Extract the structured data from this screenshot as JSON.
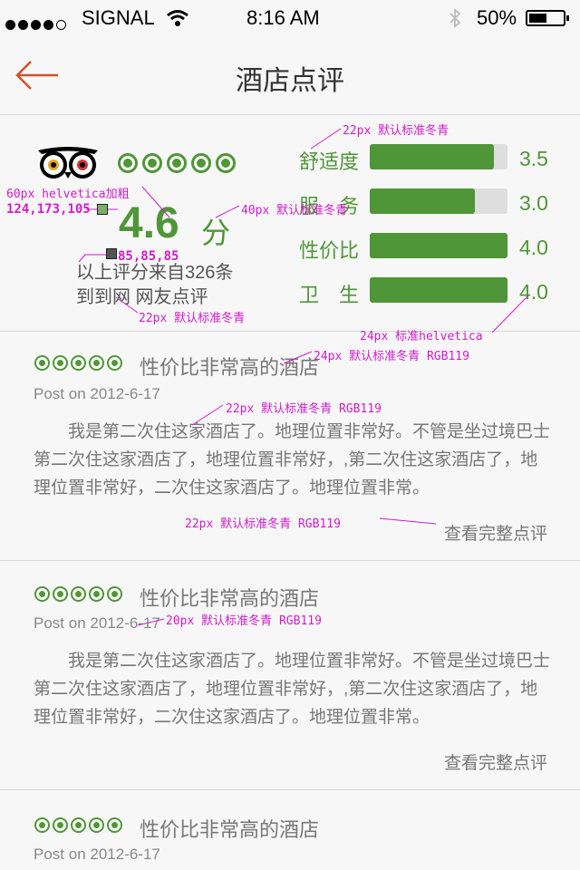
{
  "status_bar": {
    "carrier": "SIGNAL",
    "time": "8:16 AM",
    "battery": "50%",
    "signal_dots_filled": 4,
    "signal_dots_total": 5
  },
  "nav": {
    "title": "酒店点评",
    "back_icon": "back-arrow-icon"
  },
  "summary": {
    "logo": "tripadvisor-owl-logo",
    "score": "4.6",
    "score_unit": "分",
    "rating_dots": 5,
    "source_text_line1": "以上评分来自326条",
    "source_text_line2": "到到网 网友点评",
    "categories": [
      {
        "label": "舒适度",
        "value": "3.5",
        "fill": 0.9
      },
      {
        "label": "服　务",
        "value": "3.0",
        "fill": 0.76
      },
      {
        "label": "性价比",
        "value": "4.0",
        "fill": 1.0
      },
      {
        "label": "卫　生",
        "value": "4.0",
        "fill": 1.0
      }
    ]
  },
  "reviews": [
    {
      "title": "性价比非常高的酒店",
      "date": "Post on 2012-6-17",
      "body": "我是第二次住这家酒店了。地理位置非常好。不管是坐过境巴士第二次住这家酒店了，地理位置非常好，,第二次住这家酒店了，地理位置非常好，二次住这家酒店了。地理位置非常。",
      "link": "查看完整点评"
    },
    {
      "title": "性价比非常高的酒店",
      "date": "Post on 2012-6-17",
      "body": "我是第二次住这家酒店了。地理位置非常好。不管是坐过境巴士第二次住这家酒店了，地理位置非常好，,第二次住这家酒店了，地理位置非常好，二次住这家酒店了。地理位置非常。",
      "link": "查看完整点评"
    },
    {
      "title": "性价比非常高的酒店",
      "date": "Post on 2012-6-17"
    }
  ],
  "annotations": {
    "a1": "22px 默认标准冬青",
    "a2": "60px helvetica加粗",
    "a3": "124,173,105",
    "a4": "40px 默认标准冬青",
    "a5": "85,85,85",
    "a6": "22px 默认标准冬青",
    "a7": "24px 标准helvetica",
    "a8": "24px 默认标准冬青  RGB119",
    "a9": "22px 默认标准冬青  RGB119",
    "a10": "22px 默认标准冬青  RGB119",
    "a11": "20px 默认标准冬青  RGB119"
  },
  "colors": {
    "accent_green": "#4f9638",
    "back_arrow": "#d2502b",
    "text_gray": "#777777",
    "annotation": "#d21bcd",
    "swatch1": "#7cad69",
    "swatch2": "#555555"
  }
}
